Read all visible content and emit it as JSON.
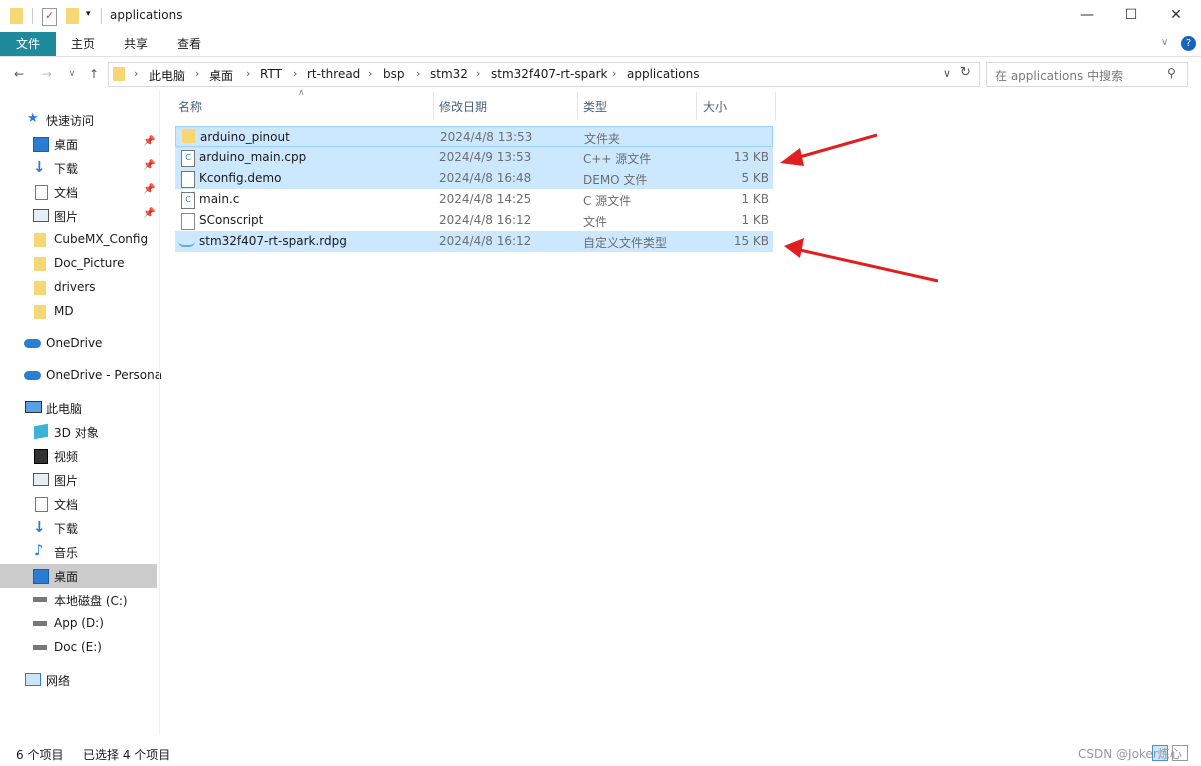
{
  "window": {
    "title": "applications"
  },
  "ribbon": {
    "tabs": [
      "文件",
      "主页",
      "共享",
      "查看"
    ]
  },
  "breadcrumb": [
    "此电脑",
    "桌面",
    "RTT",
    "rt-thread",
    "bsp",
    "stm32",
    "stm32f407-rt-spark",
    "applications"
  ],
  "search": {
    "placeholder": "在 applications 中搜索"
  },
  "sidebar": {
    "quick_access": "快速访问",
    "quick_items": [
      "桌面",
      "下载",
      "文档",
      "图片",
      "CubeMX_Config",
      "Doc_Picture",
      "drivers",
      "MD"
    ],
    "onedrive": "OneDrive",
    "onedrive_personal": "OneDrive - Persona",
    "this_pc": "此电脑",
    "pc_items": [
      "3D 对象",
      "视频",
      "图片",
      "文档",
      "下载",
      "音乐",
      "桌面",
      "本地磁盘 (C:)",
      "App (D:)",
      "Doc (E:)"
    ],
    "network": "网络",
    "selected_item": "桌面"
  },
  "columns": {
    "name": "名称",
    "date": "修改日期",
    "type": "类型",
    "size": "大小"
  },
  "files": [
    {
      "name": "arduino_pinout",
      "date": "2024/4/8 13:53",
      "type": "文件夹",
      "size": "",
      "icon": "folder-icon",
      "selected": true
    },
    {
      "name": "arduino_main.cpp",
      "date": "2024/4/9 13:53",
      "type": "C++ 源文件",
      "size": "13 KB",
      "icon": "cpp-file-icon",
      "selected": true
    },
    {
      "name": "Kconfig.demo",
      "date": "2024/4/8 16:48",
      "type": "DEMO 文件",
      "size": "5 KB",
      "icon": "generic-file-icon",
      "selected": true
    },
    {
      "name": "main.c",
      "date": "2024/4/8 14:25",
      "type": "C 源文件",
      "size": "1 KB",
      "icon": "c-file-icon",
      "selected": false
    },
    {
      "name": "SConscript",
      "date": "2024/4/8 16:12",
      "type": "文件",
      "size": "1 KB",
      "icon": "blank-file-icon",
      "selected": false
    },
    {
      "name": "stm32f407-rt-spark.rdpg",
      "date": "2024/4/8 16:12",
      "type": "自定义文件类型",
      "size": "15 KB",
      "icon": "rdpg-file-icon",
      "selected": true
    }
  ],
  "status": {
    "count": "6 个项目",
    "selected": "已选择 4 个项目"
  },
  "watermark": "CSDN @Joker炼心",
  "colors": {
    "ribbon_active": "#1f8a9c",
    "selection": "#cce8ff",
    "arrow": "#e02020",
    "folder": "#f7d774"
  }
}
